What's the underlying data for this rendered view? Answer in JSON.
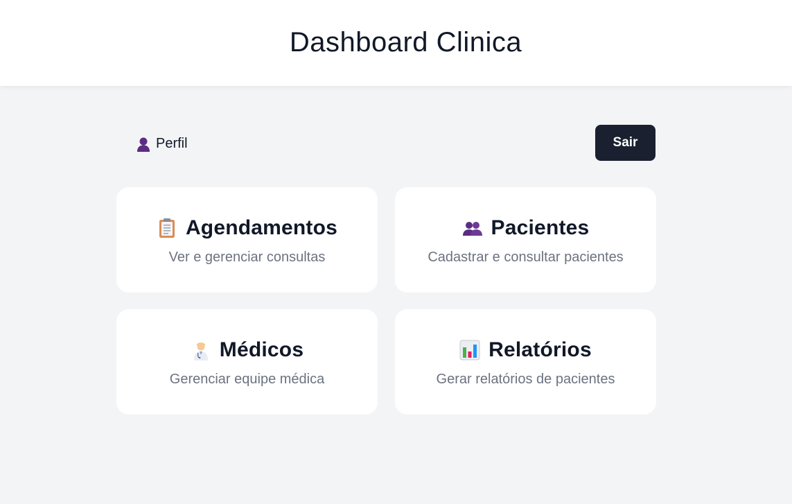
{
  "header": {
    "title": "Dashboard Clinica"
  },
  "topbar": {
    "profile": {
      "label": "Perfil",
      "icon": "user-icon"
    },
    "logout_label": "Sair"
  },
  "cards": [
    {
      "title": "Agendamentos",
      "description": "Ver e gerenciar consultas",
      "icon": "clipboard-icon"
    },
    {
      "title": "Pacientes",
      "description": "Cadastrar e consultar pacientes",
      "icon": "users-icon"
    },
    {
      "title": "Médicos",
      "description": "Gerenciar equipe médica",
      "icon": "doctor-icon"
    },
    {
      "title": "Relatórios",
      "description": "Gerar relatórios de pacientes",
      "icon": "bar-chart-icon"
    }
  ],
  "colors": {
    "background": "#f3f4f6",
    "card": "#ffffff",
    "logout_button": "#1b2030",
    "title_text": "#111827",
    "muted_text": "#6b7280",
    "user_icon": "#5b2c83"
  }
}
